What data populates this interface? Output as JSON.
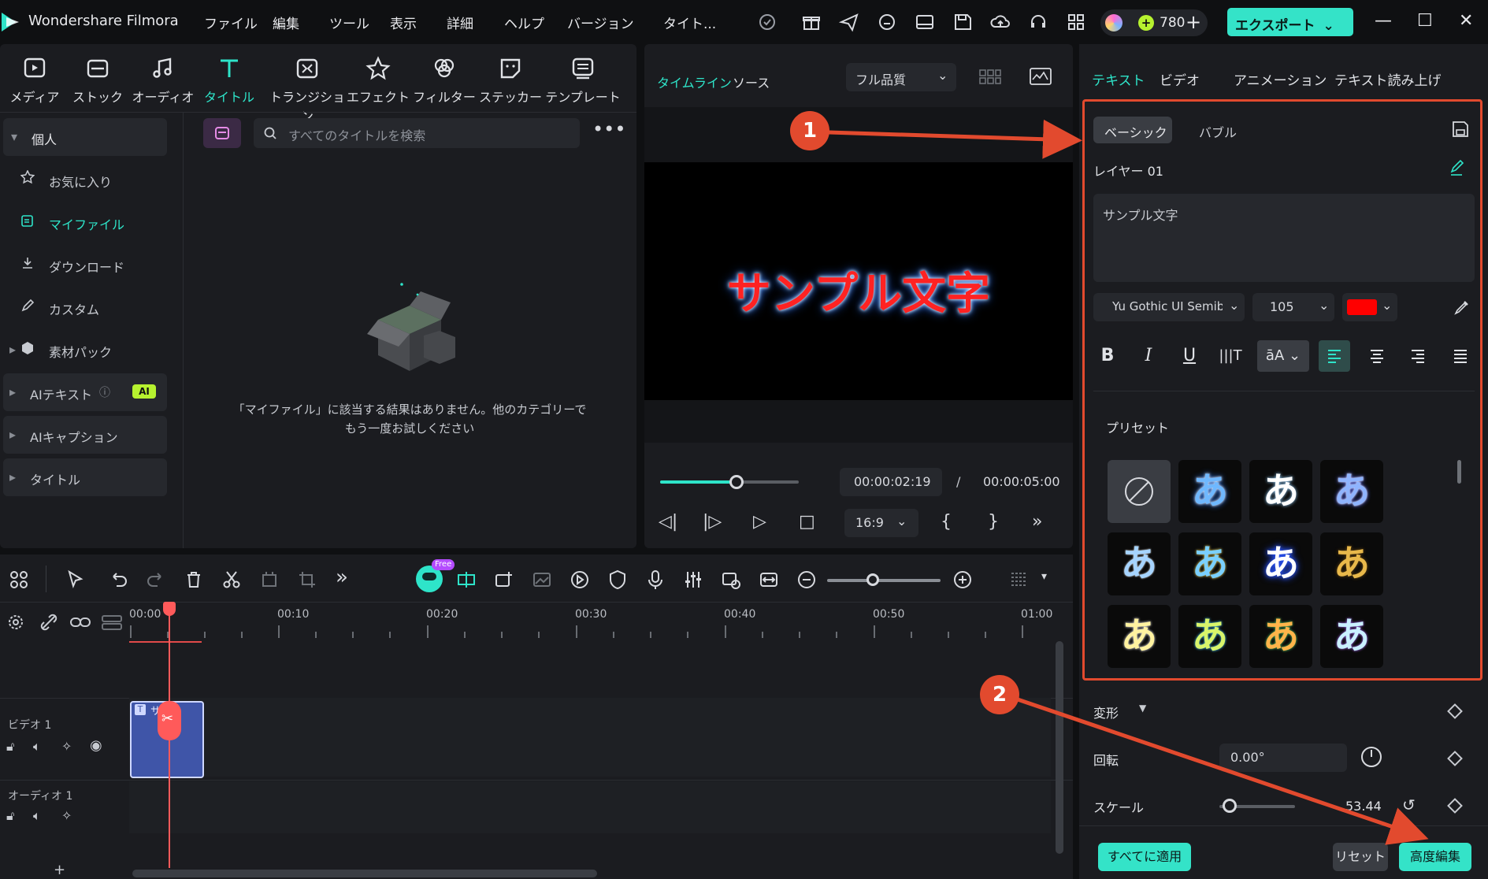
{
  "titlebar": {
    "app_name": "Wondershare Filmora",
    "menus": [
      "ファイル",
      "編集",
      "ツール",
      "表示",
      "詳細",
      "ヘルプ",
      "バージョン",
      "タイト..."
    ],
    "credits": "780",
    "export_label": "エクスポート",
    "accent": "#34e3c8"
  },
  "media_tabs": [
    "メディア",
    "ストック",
    "オーディオ",
    "タイトル",
    "トランジション",
    "エフェクト",
    "フィルター",
    "ステッカー",
    "テンプレート"
  ],
  "sidebar": {
    "personal": "個人",
    "favorites": "お気に入り",
    "my_files": "マイファイル",
    "download": "ダウンロード",
    "custom": "カスタム",
    "material_pack": "素材パック",
    "ai_text": "AIテキスト",
    "ai_badge": "AI",
    "ai_caption": "AIキャプション",
    "title": "タイトル"
  },
  "library": {
    "search_placeholder": "すべてのタイトルを検索",
    "empty_line1": "「マイファイル」に該当する結果はありません。他のカテゴリーで",
    "empty_line2": "もう一度お試しください"
  },
  "player": {
    "tab_timeline": "タイムライン",
    "tab_source": "ソース",
    "quality": "フル品質",
    "preview_text": "サンプル文字",
    "current_time": "00:00:02:19",
    "separator": "/",
    "total_time": "00:00:05:00",
    "aspect": "16:9",
    "progress": 0.55
  },
  "inspector": {
    "tabs": [
      "テキスト",
      "ビデオ",
      "アニメーション",
      "テキスト読み上げ"
    ],
    "sub_basic": "ベーシック",
    "sub_bubble": "バブル",
    "layer": "レイヤー 01",
    "text_value": "サンプル文字",
    "font": "Yu Gothic UI Semibol",
    "size": "105",
    "color": "#ff0000",
    "preset_label": "プリセット",
    "preset_glyph": "あ",
    "transform": "変形",
    "rotation_label": "回転",
    "rotation_value": "0.00°",
    "scale_label": "スケール",
    "scale_value": "53.44",
    "apply_all": "すべてに適用",
    "reset": "リセット",
    "advanced": "高度編集"
  },
  "timeline": {
    "ruler": [
      "00:00",
      "00:10",
      "00:20",
      "00:30",
      "00:40",
      "00:50",
      "01:00"
    ],
    "video_track": "ビデオ 1",
    "audio_track": "オーディオ 1",
    "clip_label": "サ 字",
    "free_badge": "Free"
  },
  "annotations": {
    "badge1": "1",
    "badge2": "2",
    "color": "#e24a2e"
  }
}
